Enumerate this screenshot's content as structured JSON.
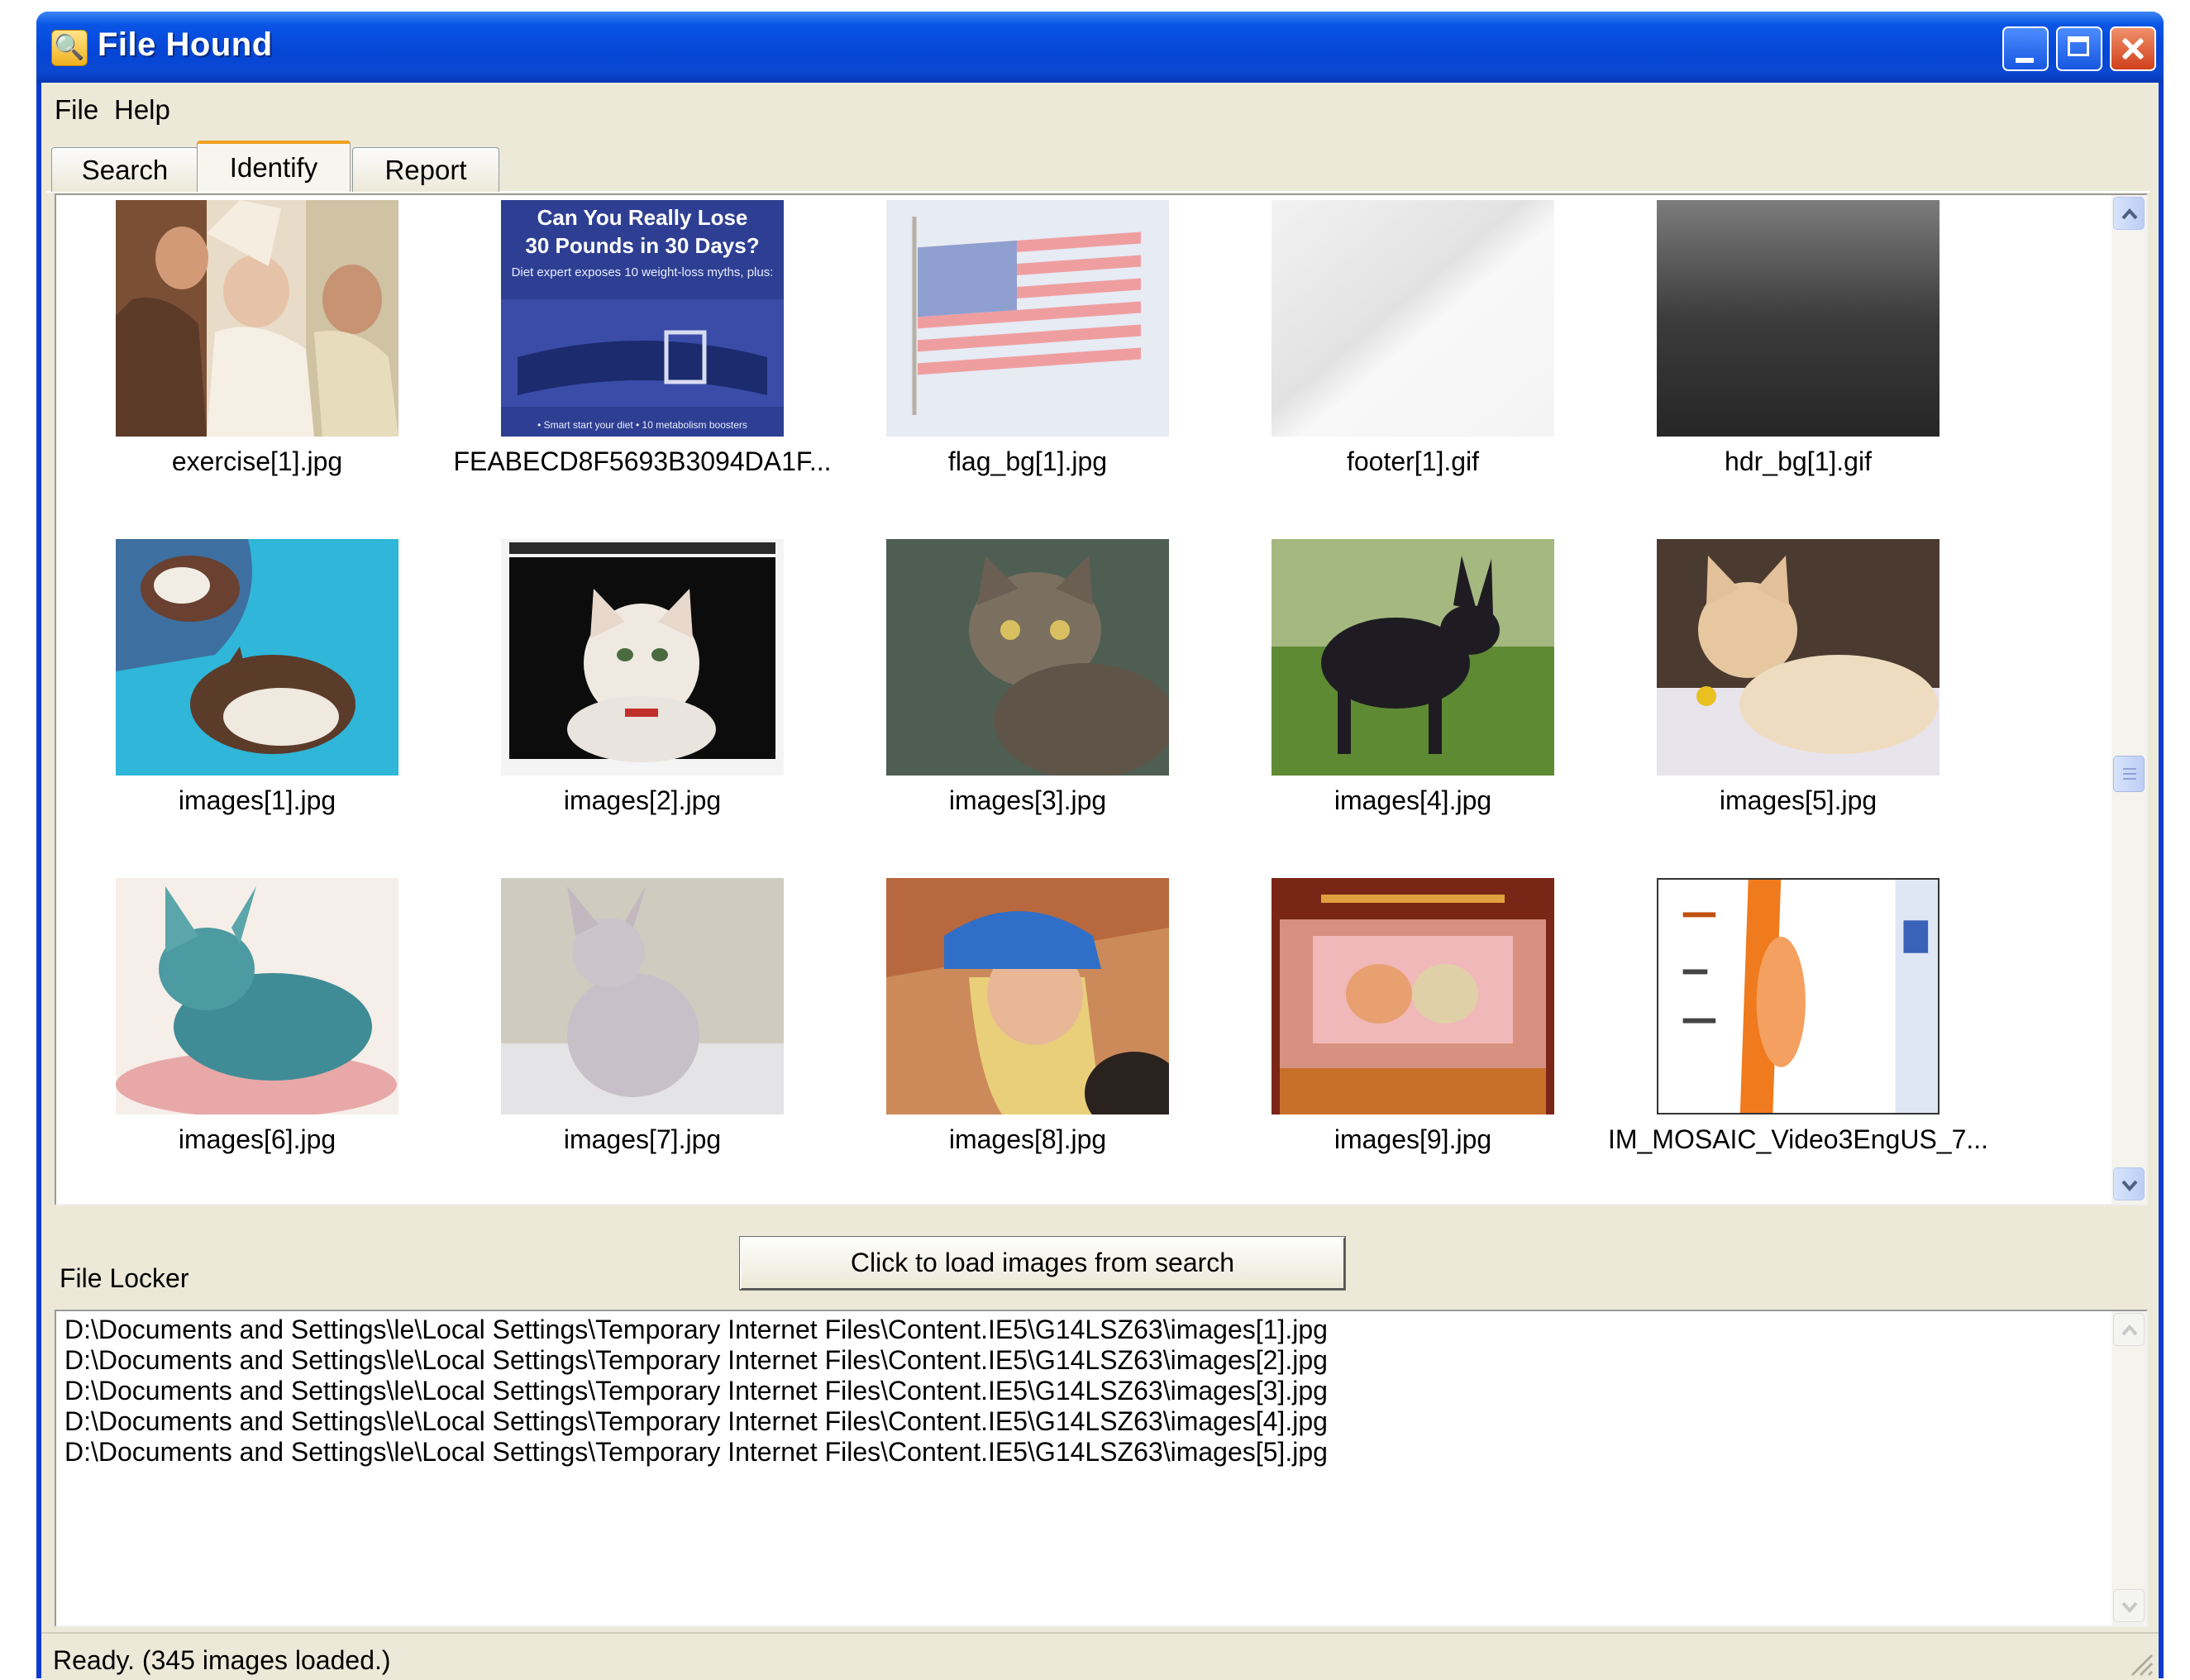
{
  "window": {
    "title": "File Hound"
  },
  "menu": {
    "items": [
      "File",
      "Help"
    ]
  },
  "tabs": [
    {
      "label": "Search",
      "active": false
    },
    {
      "label": "Identify",
      "active": true
    },
    {
      "label": "Report",
      "active": false
    }
  ],
  "gallery": {
    "items": [
      {
        "name": "exercise[1].jpg"
      },
      {
        "name": "FEABECD8F5693B3094DA1F..."
      },
      {
        "name": "flag_bg[1].jpg"
      },
      {
        "name": "footer[1].gif"
      },
      {
        "name": "hdr_bg[1].gif"
      },
      {
        "name": "images[1].jpg"
      },
      {
        "name": "images[2].jpg"
      },
      {
        "name": "images[3].jpg"
      },
      {
        "name": "images[4].jpg"
      },
      {
        "name": "images[5].jpg"
      },
      {
        "name": "images[6].jpg"
      },
      {
        "name": "images[7].jpg"
      },
      {
        "name": "images[8].jpg"
      },
      {
        "name": "images[9].jpg"
      },
      {
        "name": "IM_MOSAIC_Video3EngUS_7..."
      }
    ],
    "ad_text": {
      "headline_1": "Can You Really Lose",
      "headline_2": "30 Pounds in 30 Days?",
      "subline": "Diet expert exposes 10 weight-loss myths, plus:",
      "footer": "• Smart start your diet  • 10 metabolism boosters"
    }
  },
  "load_button": {
    "label": "Click to load images from search"
  },
  "file_locker": {
    "label": "File Locker",
    "paths": [
      "D:\\Documents and Settings\\le\\Local Settings\\Temporary Internet Files\\Content.IE5\\G14LSZ63\\images[1].jpg",
      "D:\\Documents and Settings\\le\\Local Settings\\Temporary Internet Files\\Content.IE5\\G14LSZ63\\images[2].jpg",
      "D:\\Documents and Settings\\le\\Local Settings\\Temporary Internet Files\\Content.IE5\\G14LSZ63\\images[3].jpg",
      "D:\\Documents and Settings\\le\\Local Settings\\Temporary Internet Files\\Content.IE5\\G14LSZ63\\images[4].jpg",
      "D:\\Documents and Settings\\le\\Local Settings\\Temporary Internet Files\\Content.IE5\\G14LSZ63\\images[5].jpg"
    ]
  },
  "status": {
    "text": "Ready.  (345 images loaded.)"
  }
}
